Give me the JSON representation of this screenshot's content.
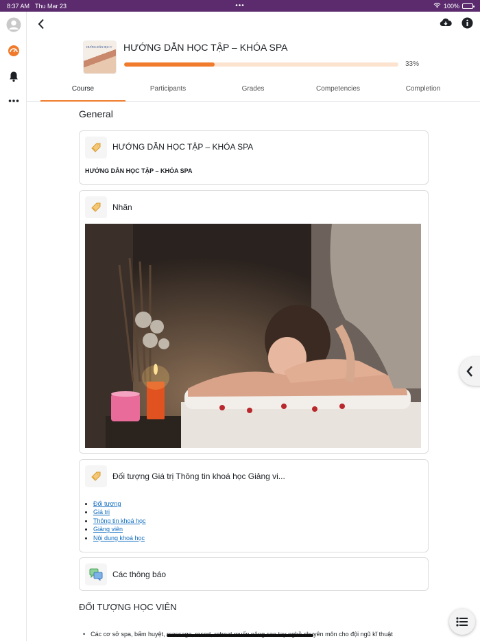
{
  "status_bar": {
    "time": "8:37 AM",
    "date": "Thu Mar 23",
    "battery": "100%"
  },
  "rail": {
    "icons": [
      "avatar-icon",
      "dashboard-icon",
      "bell-icon",
      "more-icon"
    ]
  },
  "header": {
    "course_title": "HƯỚNG DẪN HỌC TẬP – KHÓA SPA",
    "thumbnail_text": "HƯỚNG DẪN HỌC T",
    "progress_percent": 33,
    "progress_label": "33%"
  },
  "tabs": [
    {
      "label": "Course",
      "active": true
    },
    {
      "label": "Participants",
      "active": false
    },
    {
      "label": "Grades",
      "active": false
    },
    {
      "label": "Competencies",
      "active": false
    },
    {
      "label": "Completion",
      "active": false
    }
  ],
  "main": {
    "section_title": "General",
    "activities": [
      {
        "name": "HƯỚNG DẪN HỌC TẬP – KHÓA SPA",
        "subtext": "HƯỚNG DẪN HỌC TẬP – KHÓA SPA",
        "icon": "label-icon"
      },
      {
        "name": "Nhãn",
        "icon": "label-icon"
      },
      {
        "name": "Đối tượng Giá trị Thông tin khoá học Giảng vi...",
        "icon": "label-icon"
      },
      {
        "name": "Các thông báo",
        "icon": "forum-icon"
      }
    ],
    "links": [
      "Đối tượng",
      "Giá trị",
      "Thông tin khoá học",
      "Giảng viên",
      "Nội dung khoá học"
    ],
    "heading": "ĐỐI TƯỢNG HỌC VIÊN",
    "bullet": "Các cơ sở spa, bấm huyệt, massage, resort, retreat muốn nâng cao tay nghề chuyên môn cho đội ngũ kĩ thuật"
  },
  "colors": {
    "accent": "#f07b2c",
    "status_bar": "#5b2b6e",
    "link": "#0f6cbf"
  }
}
